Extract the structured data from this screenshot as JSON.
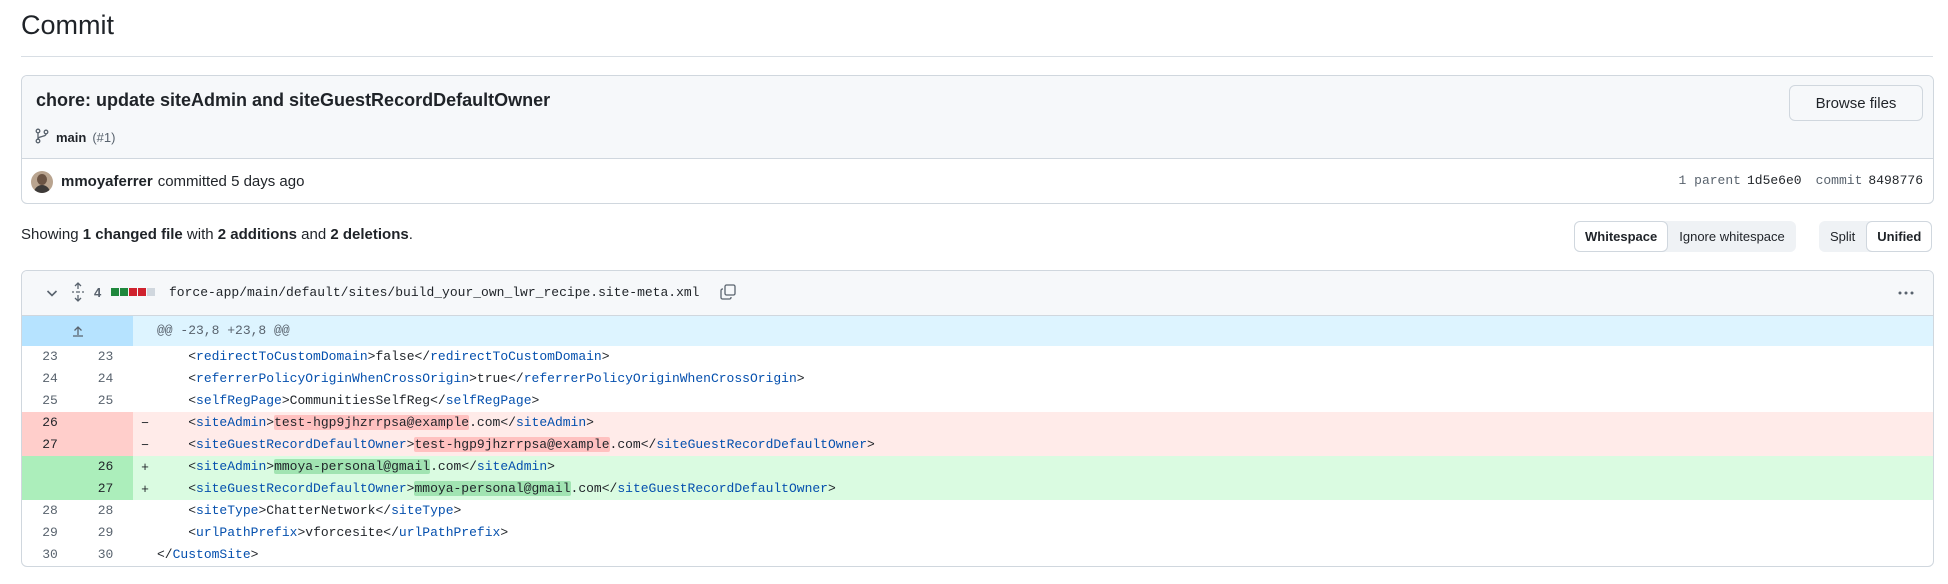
{
  "page": {
    "title": "Commit"
  },
  "commit": {
    "message": "chore: update siteAdmin and siteGuestRecordDefaultOwner",
    "browse_label": "Browse files",
    "branch": "main",
    "pr": "(#1)",
    "author": "mmoyaferrer",
    "time": "committed 5 days ago",
    "parent_label": "1 parent",
    "parent_sha": "1d5e6e0",
    "commit_label": "commit",
    "commit_sha": "8498776"
  },
  "summary": {
    "prefix": "Showing",
    "changed": "1 changed file",
    "with": "with",
    "additions": "2 additions",
    "and": "and",
    "deletions": "2 deletions",
    "end": "."
  },
  "toolbar": {
    "whitespace": "Whitespace",
    "ignore_whitespace": "Ignore whitespace",
    "split": "Split",
    "unified": "Unified"
  },
  "file": {
    "count": "4",
    "path": "force-app/main/default/sites/build_your_own_lwr_recipe.site-meta.xml",
    "diffstat_colors": [
      "#1f883d",
      "#1f883d",
      "#cf222e",
      "#cf222e",
      "#d0d7de"
    ]
  },
  "diff": {
    "hunk": "@@ -23,8 +23,8 @@",
    "rows": [
      {
        "type": "ctx",
        "old": "23",
        "new": "23",
        "sign": "",
        "indent": "    ",
        "tag": "redirectToCustomDomain",
        "pre": "",
        "hl": "",
        "post": "false",
        "close": "redirectToCustomDomain"
      },
      {
        "type": "ctx",
        "old": "24",
        "new": "24",
        "sign": "",
        "indent": "    ",
        "tag": "referrerPolicyOriginWhenCrossOrigin",
        "pre": "",
        "hl": "",
        "post": "true",
        "close": "referrerPolicyOriginWhenCrossOrigin"
      },
      {
        "type": "ctx",
        "old": "25",
        "new": "25",
        "sign": "",
        "indent": "    ",
        "tag": "selfRegPage",
        "pre": "",
        "hl": "",
        "post": "CommunitiesSelfReg",
        "close": "selfRegPage"
      },
      {
        "type": "del",
        "old": "26",
        "new": "",
        "sign": "−",
        "indent": "    ",
        "tag": "siteAdmin",
        "pre": "",
        "hl": "test-hgp9jhzrrpsa@example",
        "post": ".com",
        "close": "siteAdmin"
      },
      {
        "type": "del",
        "old": "27",
        "new": "",
        "sign": "−",
        "indent": "    ",
        "tag": "siteGuestRecordDefaultOwner",
        "pre": "",
        "hl": "test-hgp9jhzrrpsa@example",
        "post": ".com",
        "close": "siteGuestRecordDefaultOwner"
      },
      {
        "type": "add",
        "old": "",
        "new": "26",
        "sign": "+",
        "indent": "    ",
        "tag": "siteAdmin",
        "pre": "",
        "hl": "mmoya-personal@gmail",
        "post": ".com",
        "close": "siteAdmin"
      },
      {
        "type": "add",
        "old": "",
        "new": "27",
        "sign": "+",
        "indent": "    ",
        "tag": "siteGuestRecordDefaultOwner",
        "pre": "",
        "hl": "mmoya-personal@gmail",
        "post": ".com",
        "close": "siteGuestRecordDefaultOwner"
      },
      {
        "type": "ctx",
        "old": "28",
        "new": "28",
        "sign": "",
        "indent": "    ",
        "tag": "siteType",
        "pre": "",
        "hl": "",
        "post": "ChatterNetwork",
        "close": "siteType"
      },
      {
        "type": "ctx",
        "old": "29",
        "new": "29",
        "sign": "",
        "indent": "    ",
        "tag": "urlPathPrefix",
        "pre": "",
        "hl": "",
        "post": "vforcesite",
        "close": "urlPathPrefix"
      },
      {
        "type": "ctx",
        "old": "30",
        "new": "30",
        "sign": "",
        "indent": "",
        "tag": "",
        "pre": "",
        "hl": "",
        "post": "",
        "close": "CustomSite"
      }
    ]
  }
}
